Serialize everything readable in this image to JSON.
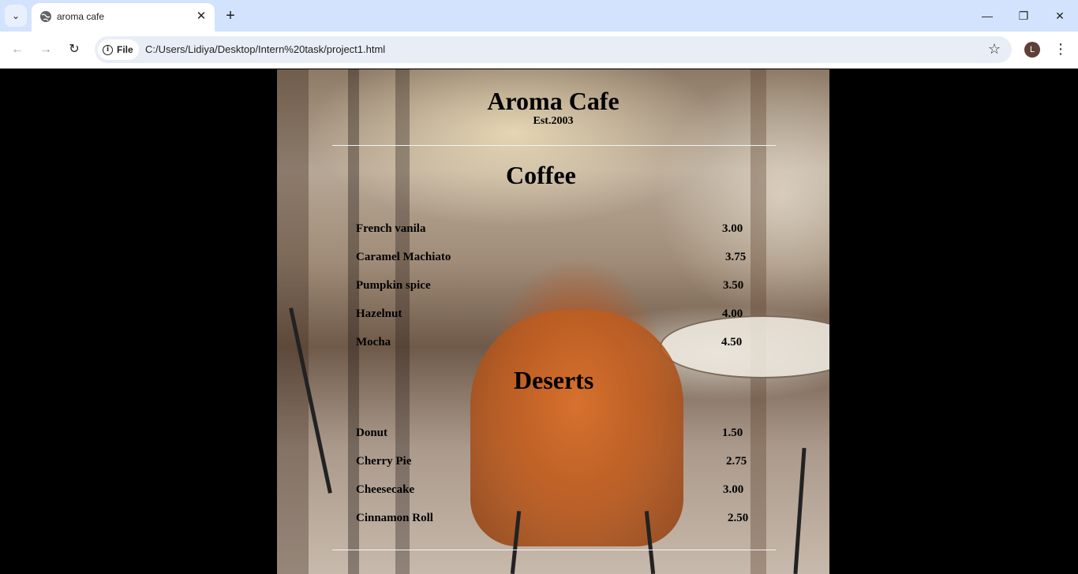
{
  "browser": {
    "tab_title": "aroma cafe",
    "site_chip_label": "File",
    "url": "C:/Users/Lidiya/Desktop/Intern%20task/project1.html",
    "profile_initial": "L"
  },
  "page": {
    "cafe_name": "Aroma Cafe",
    "established": "Est.2003",
    "sections": [
      {
        "title": "Coffee",
        "items": [
          {
            "name": "French vanila",
            "price": "3.00"
          },
          {
            "name": "Caramel Machiato",
            "price": "3.75"
          },
          {
            "name": "Pumpkin spice",
            "price": "3.50"
          },
          {
            "name": "Hazelnut",
            "price": "4.00"
          },
          {
            "name": "Mocha",
            "price": "4.50"
          }
        ]
      },
      {
        "title": "Deserts",
        "items": [
          {
            "name": "Donut",
            "price": "1.50"
          },
          {
            "name": "Cherry Pie",
            "price": "2.75"
          },
          {
            "name": "Cheesecake",
            "price": "3.00"
          },
          {
            "name": "Cinnamon Roll",
            "price": "2.50"
          }
        ]
      }
    ]
  }
}
